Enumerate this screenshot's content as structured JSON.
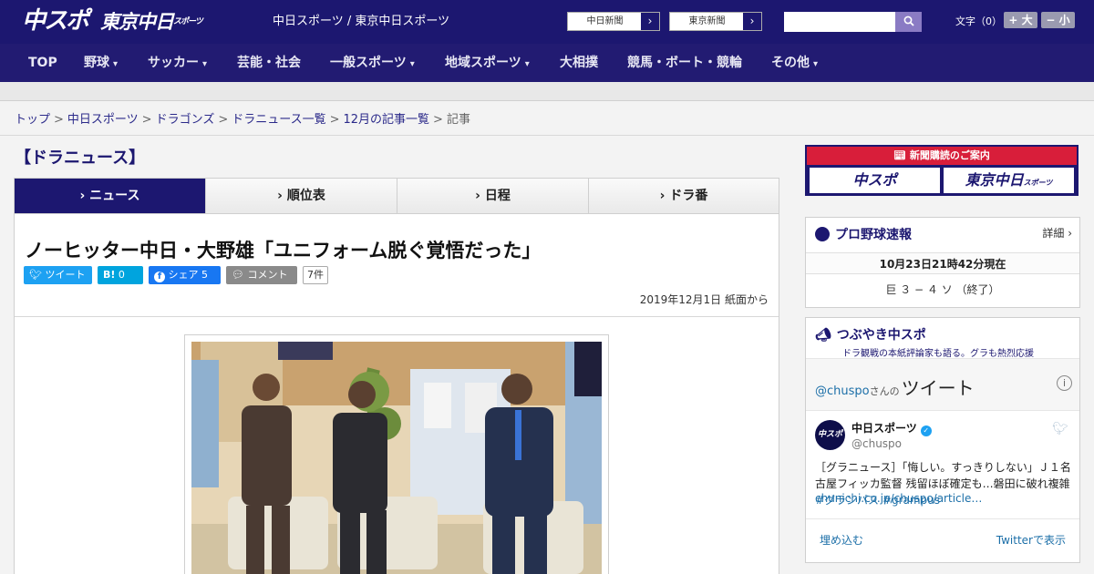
{
  "header": {
    "logo_main": "中スポ",
    "logo_tokyo": "東京中日",
    "logo_tokyo_sub": "スポーツ",
    "site_title": "中日スポーツ / 東京中日スポーツ",
    "ext_links": [
      "中日新聞",
      "東京新聞"
    ],
    "search_placeholder": "",
    "font_size_label": "文字（0）",
    "font_bigger": "+ 大",
    "font_smaller": "− 小"
  },
  "nav": {
    "items": [
      "TOP",
      "野球",
      "サッカー",
      "芸能・社会",
      "一般スポーツ",
      "地域スポーツ",
      "大相撲",
      "競馬・ボート・競輪",
      "その他"
    ]
  },
  "breadcrumb": {
    "items": [
      "トップ",
      "中日スポーツ",
      "ドラゴンズ",
      "ドラニュース一覧",
      "12月の記事一覧"
    ],
    "current": "記事"
  },
  "main": {
    "section_title": "【ドラニュース】",
    "tabs": [
      "ニュース",
      "順位表",
      "日程",
      "ドラ番"
    ],
    "active_tab": 0,
    "headline": "ノーヒッター中日・大野雄「ユニフォーム脱ぐ覚悟だった」",
    "share": {
      "tweet": "ツイート",
      "hatena": "B!",
      "hatena_count": "0",
      "facebook": "シェア",
      "facebook_count": "5",
      "comment": "コメント",
      "comment_count": "7件"
    },
    "date": "2019年12月1日 紙面から"
  },
  "sidebar": {
    "banner_top": "新聞購読のご案内",
    "banner_left": "中スポ",
    "banner_right": "東京中日",
    "banner_right_sub": "スポーツ",
    "score": {
      "title": "プロ野球速報",
      "detail": "詳細 ›",
      "time": "10月23日21時42分現在",
      "game": "巨 ３ − ４ ソ （終了）"
    },
    "tweets": {
      "title": "つぶやき中スポ",
      "subtitle": "ドラ観戦の本紙評論家も語る。グラも熱烈応援",
      "handle_head": "@chuspo",
      "handle_suffix": "さんの",
      "head_word": "ツイート",
      "avatar_text": "中スポ",
      "name": "中日スポーツ",
      "handle": "@chuspo",
      "text": "［グラニュース］「悔しい。すっきりしない」Ｊ１名古屋フィッカ監督 残留ほぼ確定も…磐田に破れ複雑",
      "tag1": "#グランパス",
      "tag2": "#grampus",
      "link": "chunichi.co.jp/chuspo/article…",
      "embed": "埋め込む",
      "view": "Twitterで表示"
    }
  },
  "colors": {
    "brand": "#1c1770",
    "banner_red": "#d81e3a",
    "twitter": "#1da1f2",
    "hatena": "#00a4de",
    "facebook": "#1877f2",
    "comment_gray": "#8a8a8a"
  }
}
